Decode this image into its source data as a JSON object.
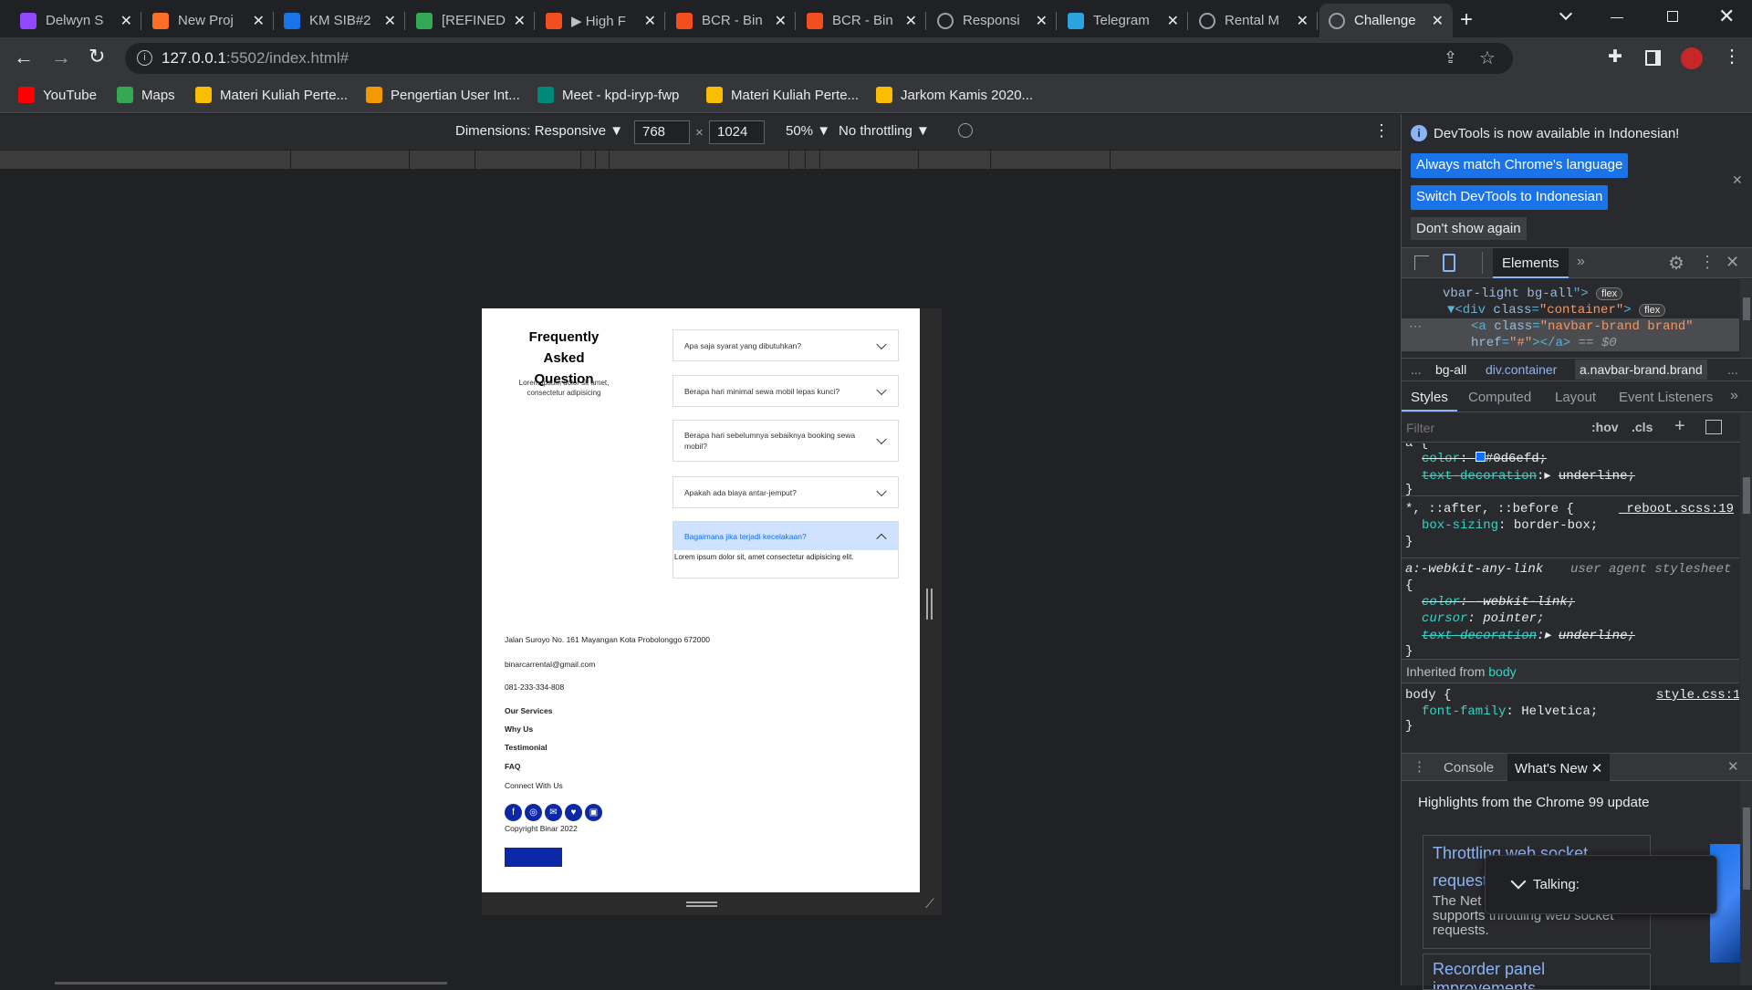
{
  "tabs": [
    {
      "title": "Delwyn S",
      "icon": "twitch-icon",
      "color": "#9146ff"
    },
    {
      "title": "New Proj",
      "icon": "gitlab-icon",
      "color": "#fc6d26"
    },
    {
      "title": "KM SIB#2",
      "icon": "classroom-icon",
      "color": "#1a73e8"
    },
    {
      "title": "[REFINED",
      "icon": "drive-icon",
      "color": "#34a853"
    },
    {
      "title": "▶ High F",
      "icon": "figma-icon",
      "color": "#f24e1e"
    },
    {
      "title": "BCR - Bin",
      "icon": "figma-icon",
      "color": "#f24e1e"
    },
    {
      "title": "BCR - Bin",
      "icon": "figma-icon",
      "color": "#f24e1e"
    },
    {
      "title": "Responsi",
      "icon": "globe-icon",
      "color": "#9aa0a6"
    },
    {
      "title": "Telegram",
      "icon": "telegram-icon",
      "color": "#2aa3df"
    },
    {
      "title": "Rental M",
      "icon": "globe-icon",
      "color": "#9aa0a6"
    },
    {
      "title": "Challenge",
      "icon": "globe-icon",
      "color": "#9aa0a6",
      "active": true
    }
  ],
  "address": {
    "host": "127.0.0.1",
    "path": ":5502/index.html#"
  },
  "bookmarks": [
    {
      "label": "YouTube",
      "icon": "youtube-icon",
      "color": "#ff0000"
    },
    {
      "label": "Maps",
      "icon": "maps-icon",
      "color": "#34a853"
    },
    {
      "label": "Materi Kuliah Perte...",
      "icon": "drive-icon",
      "color": "#fbbc04"
    },
    {
      "label": "Pengertian User Int...",
      "icon": "bookmark-icon",
      "color": "#f29900"
    },
    {
      "label": "Meet - kpd-iryp-fwp",
      "icon": "meet-icon",
      "color": "#00897b"
    },
    {
      "label": "Materi Kuliah Perte...",
      "icon": "classroom-icon",
      "color": "#fbbc04"
    },
    {
      "label": "Jarkom Kamis 2020...",
      "icon": "classroom-icon",
      "color": "#fbbc04"
    }
  ],
  "device_toolbar": {
    "dimensions_label": "Dimensions: Responsive ▼",
    "width": "768",
    "times": "×",
    "height": "1024",
    "zoom": "50% ▼",
    "throttle": "No throttling ▼"
  },
  "page": {
    "faq_title": "Frequently Asked Question",
    "faq_subtitle": "Lorem ipsum dolor sit amet, consectetur adipisicing",
    "faq_items": [
      {
        "q": "Apa saja syarat yang dibutuhkan?"
      },
      {
        "q": "Berapa hari minimal sewa mobil lepas kunci?"
      },
      {
        "q": "Berapa hari sebelumnya sebaiknya booking sewa mobil?"
      },
      {
        "q": "Apakah ada biaya antar-jemput?"
      },
      {
        "q": "Bagaimana jika terjadi kecelakaan?",
        "open": true,
        "a": "Lorem ipsum dolor sit, amet consectetur adipisicing elit."
      }
    ],
    "footer": {
      "address": "Jalan Suroyo No. 161 Mayangan Kota Probolonggo 672000",
      "email": "binarcarrental@gmail.com",
      "phone": "081-233-334-808",
      "links": [
        "Our Services",
        "Why Us",
        "Testimonial",
        "FAQ"
      ],
      "connect": "Connect With Us",
      "social": [
        "facebook-icon",
        "instagram-icon",
        "mail-icon",
        "twitter-icon",
        "twitch-icon"
      ],
      "copyright": "Copyright Binar 2022",
      "brand_color": "#0d28a6"
    }
  },
  "devtools": {
    "banner": "DevTools is now available in Indonesian!",
    "btn_match": "Always match Chrome's language",
    "btn_switch": "Switch DevTools to Indonesian",
    "btn_dont": "Don't show again",
    "main_tab": "Elements",
    "breadcrumbs": [
      "...",
      "bg-all",
      "div.container",
      "a.navbar-brand.brand",
      "..."
    ],
    "style_tabs": [
      "Styles",
      "Computed",
      "Layout",
      "Event Listeners"
    ],
    "filter_placeholder": "Filter",
    "hov": ":hov",
    "cls": ".cls",
    "rules": {
      "r1_color_prop": "color",
      "r1_color_val": "#0d6efd;",
      "r1_td_prop": "text-decoration",
      "r1_td_val": "underline;",
      "r2_selector": "*, ::after, ::before {",
      "r2_source": "_reboot.scss:19",
      "r2_prop": "box-sizing",
      "r2_val": "border-box;",
      "r3_selector": "a:-webkit-any-link",
      "r3_source": "user agent stylesheet",
      "r3_p1": "color",
      "r3_v1": "-webkit-link;",
      "r3_p2": "cursor",
      "r3_v2": "pointer;",
      "r3_p3": "text-decoration",
      "r3_v3": "underline;",
      "inherited": "Inherited from",
      "inherited_el": "body",
      "r4_selector": "body {",
      "r4_source": "style.css:1",
      "r4_prop": "font-family",
      "r4_val": "Helvetica;"
    },
    "drawer_tabs": [
      "Console",
      "What's New"
    ],
    "whats_new_title": "Highlights from the Chrome 99 update",
    "card1_title": "Throttling web socket",
    "card1_title2": "request",
    "card1_body": "The Net",
    "card1_body2": "supports throttling web socket",
    "card1_body3": "requests.",
    "card2_title": "Recorder panel improvements",
    "talking": "Talking:"
  },
  "accent": "#1a73e8"
}
